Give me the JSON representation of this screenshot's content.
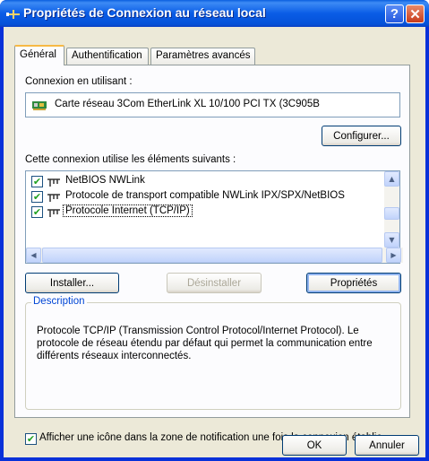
{
  "window": {
    "title": "Propriétés de Connexion au réseau local",
    "help_label": "?",
    "close_label": "✕"
  },
  "tabs": [
    {
      "label": "Général",
      "active": true
    },
    {
      "label": "Authentification",
      "active": false
    },
    {
      "label": "Paramètres avancés",
      "active": false
    }
  ],
  "connection": {
    "label": "Connexion en utilisant :",
    "adapter": "Carte réseau 3Com EtherLink XL 10/100 PCI TX (3C905B",
    "configure_button": "Configurer..."
  },
  "components": {
    "label": "Cette connexion utilise les éléments suivants :",
    "items": [
      {
        "label": "NetBIOS NWLink",
        "checked": true
      },
      {
        "label": "Protocole de transport compatible NWLink IPX/SPX/NetBIOS",
        "checked": true
      },
      {
        "label": "Protocole Internet (TCP/IP)",
        "checked": true,
        "selected": true
      }
    ],
    "install_button": "Installer...",
    "uninstall_button": "Désinstaller",
    "properties_button": "Propriétés"
  },
  "description": {
    "legend": "Description",
    "text": "Protocole TCP/IP (Transmission Control Protocol/Internet Protocol). Le protocole de réseau étendu par défaut qui permet la communication entre différents réseaux interconnectés."
  },
  "notify": {
    "label": "Afficher une icône dans la zone de notification une fois la connexion établie",
    "checked": true
  },
  "footer": {
    "ok_button": "OK",
    "cancel_button": "Annuler"
  }
}
